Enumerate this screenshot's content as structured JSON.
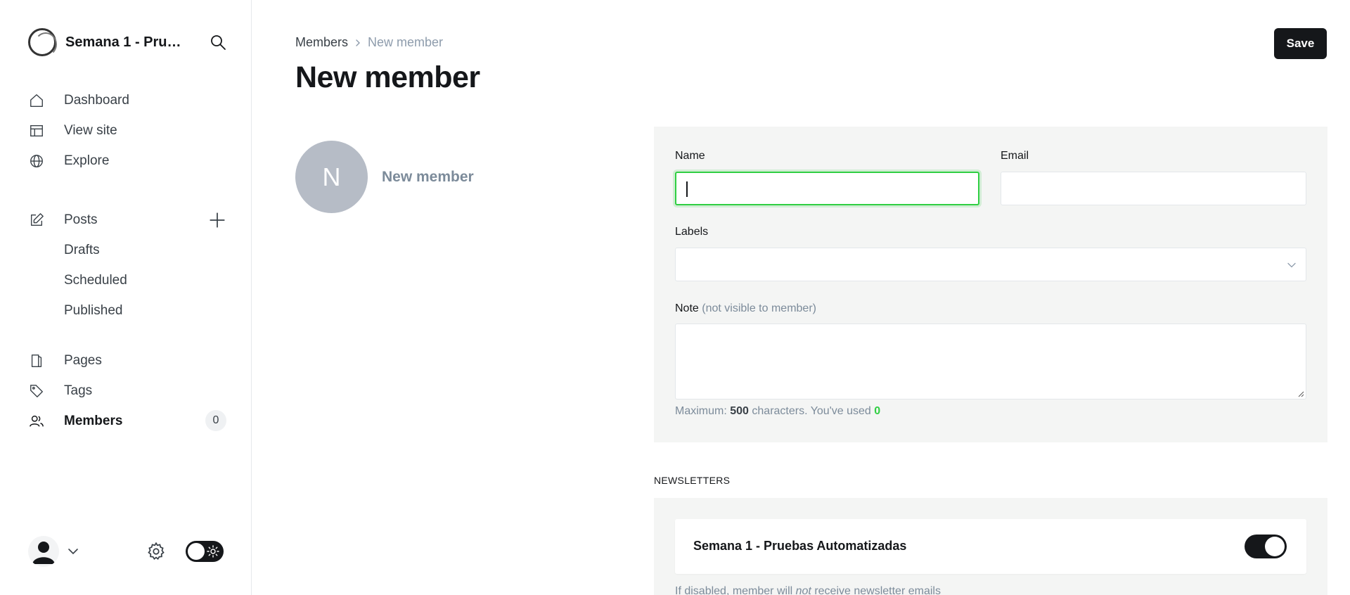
{
  "sidebar": {
    "site_title": "Semana 1 - Pruebas Automatizadas",
    "nav_main": [
      {
        "label": "Dashboard"
      },
      {
        "label": "View site"
      },
      {
        "label": "Explore"
      }
    ],
    "posts": {
      "label": "Posts",
      "sub": [
        {
          "label": "Drafts"
        },
        {
          "label": "Scheduled"
        },
        {
          "label": "Published"
        }
      ]
    },
    "nav_content": [
      {
        "label": "Pages"
      },
      {
        "label": "Tags"
      },
      {
        "label": "Members",
        "count": "0",
        "active": true
      }
    ]
  },
  "header": {
    "breadcrumb": {
      "parent": "Members",
      "current": "New member"
    },
    "title": "New member",
    "save_label": "Save"
  },
  "member_summary": {
    "avatar_initial": "N",
    "name": "New member"
  },
  "form": {
    "name_label": "Name",
    "name_value": "",
    "email_label": "Email",
    "email_value": "",
    "labels_label": "Labels",
    "note_label": "Note",
    "note_hint": "(not visible to member)",
    "note_value": "",
    "char_info_prefix": "Maximum:",
    "char_max": "500",
    "char_info_middle": "characters. You've used",
    "char_used": "0"
  },
  "newsletters": {
    "section_title": "NEWSLETTERS",
    "items": [
      {
        "name": "Semana 1 - Pruebas Automatizadas",
        "enabled": true
      }
    ],
    "hint_before": "If disabled, member will",
    "hint_emphasis": "not",
    "hint_after": "receive newsletter emails"
  },
  "colors": {
    "accent_green": "#30cf43",
    "primary_dark": "#15171a",
    "muted": "#7c8b9a",
    "card_bg": "#f4f5f4"
  }
}
